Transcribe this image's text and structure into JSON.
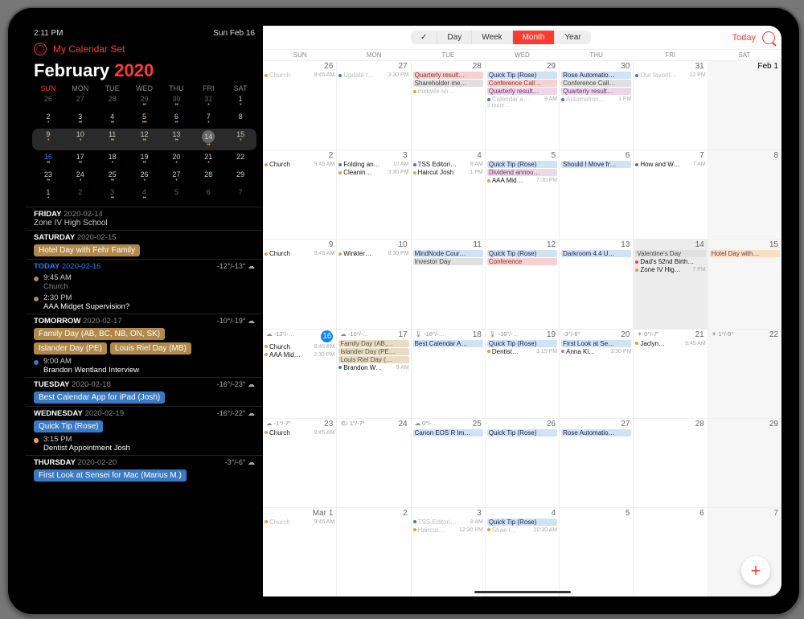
{
  "status": {
    "time": "2:11 PM",
    "date": "Sun Feb 16"
  },
  "side": {
    "calendarSet": "My Calendar Set",
    "month": "February",
    "year": "2020",
    "mini": {
      "dow": [
        "SUN",
        "MON",
        "TUE",
        "WED",
        "THU",
        "FRI",
        "SAT"
      ],
      "weeks": [
        {
          "d": [
            "26",
            "27",
            "28",
            "29",
            "30",
            "31",
            "1"
          ],
          "dim": [
            0,
            1,
            2,
            3,
            4,
            5
          ],
          "dots": [
            "",
            "",
            "",
            "••",
            "••",
            "•",
            "•"
          ]
        },
        {
          "d": [
            "2",
            "3",
            "4",
            "5",
            "6",
            "7",
            "8"
          ],
          "dots": [
            "•",
            "••",
            "••",
            "•••",
            "••",
            "•",
            ""
          ]
        },
        {
          "sel": true,
          "d": [
            "9",
            "10",
            "11",
            "12",
            "13",
            "14",
            "15"
          ],
          "dots": [
            "•",
            "•",
            "••",
            "••",
            "••",
            "••",
            "•"
          ],
          "big": 5
        },
        {
          "today": 0,
          "d": [
            "16",
            "17",
            "18",
            "19",
            "20",
            "21",
            "22"
          ],
          "dots": [
            "••",
            "••",
            "•",
            "••",
            "•",
            "•",
            ""
          ]
        },
        {
          "d": [
            "23",
            "24",
            "25",
            "26",
            "27",
            "28",
            "29"
          ],
          "dots": [
            "••",
            "•",
            "••",
            "•",
            "•",
            "",
            ""
          ]
        },
        {
          "d": [
            "1",
            "2",
            "3",
            "4",
            "5",
            "6",
            "7"
          ],
          "dim": [
            1,
            2,
            3,
            4,
            5,
            6
          ],
          "dots": [
            "•",
            "",
            "••",
            "••",
            "",
            "",
            ""
          ]
        }
      ]
    },
    "agenda": [
      {
        "hd": {
          "day": "FRIDAY",
          "date": "2020-02-14"
        },
        "items": [
          {
            "kind": "txt",
            "title": "Zone IV High School"
          }
        ]
      },
      {
        "hd": {
          "day": "SATURDAY",
          "date": "2020-02-15"
        },
        "items": [
          {
            "kind": "pill",
            "cls": "",
            "label": "Hotel Day with Fehr Family"
          }
        ]
      },
      {
        "hd": {
          "day": "TODAY",
          "date": "2020-02-16",
          "today": true,
          "temp": "-12°/-13°"
        },
        "items": [
          {
            "kind": "ev",
            "dot": "#b1894a",
            "time": "9:45 AM",
            "title": "Church",
            "dim": true
          },
          {
            "kind": "ev",
            "dot": "#b1894a",
            "time": "2:30 PM",
            "title": "AAA Midget Supervision?"
          }
        ]
      },
      {
        "hd": {
          "day": "TOMORROW",
          "date": "2020-02-17",
          "temp": "-10°/-19°"
        },
        "items": [
          {
            "kind": "pill",
            "cls": "",
            "label": "Family Day (AB, BC, NB, ON, SK)"
          },
          {
            "kind": "pillrow",
            "pills": [
              {
                "label": "Islander Day (PE)"
              },
              {
                "label": "Louis Riel Day (MB)"
              }
            ]
          },
          {
            "kind": "ev",
            "dot": "#3a7ac4",
            "time": "9:00 AM",
            "title": "Brandon Wentland Interview"
          }
        ]
      },
      {
        "hd": {
          "day": "TUESDAY",
          "date": "2020-02-18",
          "temp": "-16°/-23°"
        },
        "items": [
          {
            "kind": "pill",
            "cls": "blue",
            "label": "Best Calendar App for iPad (Josh)"
          }
        ]
      },
      {
        "hd": {
          "day": "WEDNESDAY",
          "date": "2020-02-19",
          "temp": "-16°/-22°"
        },
        "items": [
          {
            "kind": "pill",
            "cls": "blue",
            "label": "Quick Tip (Rose)"
          },
          {
            "kind": "ev",
            "dot": "#f0a35a",
            "time": "3:15 PM",
            "title": "Dentist Appointment Josh"
          }
        ]
      },
      {
        "hd": {
          "day": "THURSDAY",
          "date": "2020-02-20",
          "temp": "-3°/-6°"
        },
        "items": [
          {
            "kind": "pill",
            "cls": "blue",
            "label": "First Look at Sensei for Mac (Marius M.)"
          }
        ]
      }
    ]
  },
  "main": {
    "today": "Today",
    "seg": [
      {
        "l": "",
        "chk": true
      },
      {
        "l": "Day"
      },
      {
        "l": "Week"
      },
      {
        "l": "Month",
        "on": true
      },
      {
        "l": "Year"
      }
    ],
    "dow": [
      "SUN",
      "MON",
      "TUE",
      "WED",
      "THU",
      "FRI",
      "SAT"
    ],
    "rows": [
      [
        {
          "n": "26",
          "g": 1,
          "ev": [
            {
              "d": "#e0a040",
              "t": "Church",
              "tm": "9:45 AM"
            }
          ]
        },
        {
          "n": "27",
          "g": 1,
          "ev": [
            {
              "d": "#3a7ac4",
              "t": "Update t…",
              "tm": "3:30 PM"
            }
          ]
        },
        {
          "n": "28",
          "g": 1,
          "bars": [
            {
              "c": "rd",
              "t": "Quarterly result…"
            },
            {
              "c": "gy",
              "t": "Shareholder me…"
            }
          ],
          "ev": [
            {
              "d": "#e0a040",
              "t": "midwife sh…"
            }
          ]
        },
        {
          "n": "29",
          "g": 1,
          "bars": [
            {
              "c": "bl",
              "t": "Quick Tip (Rose)"
            },
            {
              "c": "rd",
              "t": "Conference Call…"
            },
            {
              "c": "pk",
              "t": "Quarterly result…"
            }
          ],
          "ev": [
            {
              "d": "#3a7ac4",
              "t": "Calendar a…",
              "tm": "9 AM"
            }
          ],
          "more": "3 more…"
        },
        {
          "n": "30",
          "g": 1,
          "bars": [
            {
              "c": "bl",
              "t": "Rose Automatio…"
            },
            {
              "c": "gy",
              "t": "Conference Call…"
            },
            {
              "c": "pk",
              "t": "Quarterly result…"
            }
          ],
          "ev": [
            {
              "d": "#3a7ac4",
              "t": "Automation…",
              "tm": "1 PM"
            }
          ]
        },
        {
          "n": "31",
          "g": 1,
          "ev": [
            {
              "d": "#3a7ac4",
              "t": "Our favorit…",
              "tm": "12 PM"
            }
          ]
        },
        {
          "n": "Feb 1",
          "bold": 1
        }
      ],
      [
        {
          "n": "2",
          "ev": [
            {
              "d": "#e0a040",
              "t": "Church",
              "tm": "9:45 AM"
            }
          ]
        },
        {
          "n": "3",
          "ev": [
            {
              "d": "#3a7ac4",
              "t": "Folding an…",
              "tm": "10 AM"
            },
            {
              "d": "#e0a040",
              "t": "Cleanin…",
              "tm": "3:30 PM"
            }
          ]
        },
        {
          "n": "4",
          "ev": [
            {
              "d": "#3a7ac4",
              "t": "TSS Editori…",
              "tm": "8 AM"
            },
            {
              "d": "#e0a040",
              "t": "Haircut Josh",
              "tm": "1 PM"
            }
          ]
        },
        {
          "n": "5",
          "bars": [
            {
              "c": "bl",
              "t": "Quick Tip (Rose)"
            },
            {
              "c": "pk",
              "t": "Dividend annou…"
            }
          ],
          "ev": [
            {
              "d": "#e0a040",
              "t": "AAA Mid…",
              "tm": "7:30 PM"
            }
          ]
        },
        {
          "n": "6",
          "bars": [
            {
              "c": "bl",
              "t": "Should I Move fr…"
            }
          ]
        },
        {
          "n": "7",
          "ev": [
            {
              "d": "#3a7ac4",
              "t": "How and W…",
              "tm": "7 AM"
            }
          ]
        },
        {
          "n": "8"
        }
      ],
      [
        {
          "n": "9",
          "ev": [
            {
              "d": "#e0a040",
              "t": "Church",
              "tm": "9:45 AM"
            }
          ]
        },
        {
          "n": "10",
          "ev": [
            {
              "d": "#e0a040",
              "t": "Winkler…",
              "tm": "8:30 PM"
            }
          ]
        },
        {
          "n": "11",
          "bars": [
            {
              "c": "bl",
              "t": "MindNode Cour…"
            },
            {
              "c": "gy",
              "t": "Investor Day"
            }
          ]
        },
        {
          "n": "12",
          "bars": [
            {
              "c": "bl",
              "t": "Quick Tip (Rose)"
            },
            {
              "c": "rd",
              "t": "Conference"
            }
          ]
        },
        {
          "n": "13",
          "bars": [
            {
              "c": "bl",
              "t": "Darkroom 4.4 U…"
            }
          ]
        },
        {
          "n": "14",
          "sel": 1,
          "bars": [
            {
              "c": "gy",
              "t": "Valentine's Day"
            }
          ],
          "ev": [
            {
              "d": "#ff3b30",
              "t": "Dad's 52nd Birth…"
            },
            {
              "d": "#e0a040",
              "t": "Zone IV Hig…",
              "tm": "7 PM"
            }
          ]
        },
        {
          "n": "15",
          "bars": [
            {
              "c": "or",
              "t": "Hotel Day with…"
            }
          ]
        }
      ],
      [
        {
          "n": "16",
          "today": 1,
          "wx": "☁ -12°/-…",
          "ev": [
            {
              "d": "#e0a040",
              "t": "Church",
              "tm": "9:45 AM"
            },
            {
              "d": "#e0a040",
              "t": "AAA Mid…",
              "tm": "2:30 PM"
            }
          ]
        },
        {
          "n": "17",
          "wx": "☁ -10°/-…",
          "bars": [
            {
              "c": "tan",
              "t": "Family Day (AB,…"
            },
            {
              "c": "tan",
              "t": "Islander Day (PE…"
            },
            {
              "c": "tan",
              "t": "Louis Riel Day (…"
            }
          ],
          "ev": [
            {
              "d": "#3a7ac4",
              "t": "Brandon W…",
              "tm": "9 AM"
            }
          ]
        },
        {
          "n": "18",
          "wx": "🌡 -16°/-…",
          "bars": [
            {
              "c": "bl",
              "t": "Best Calendar A…"
            }
          ]
        },
        {
          "n": "19",
          "wx": "🌡 -16°/-…",
          "bars": [
            {
              "c": "bl",
              "t": "Quick Tip (Rose)"
            }
          ],
          "ev": [
            {
              "d": "#e0a040",
              "t": "Dentist…",
              "tm": "3:15 PM"
            }
          ]
        },
        {
          "n": "20",
          "wx": "-3°/-6°",
          "bars": [
            {
              "c": "bl",
              "t": "First Look at Se…"
            }
          ],
          "ev": [
            {
              "d": "#cc66cc",
              "t": "Anna Ki…",
              "tm": "3:30 PM"
            }
          ]
        },
        {
          "n": "21",
          "wx": "☀ 0°/-7°",
          "ev": [
            {
              "d": "#e0a040",
              "t": "Jaclyn…",
              "tm": "9:45 AM"
            }
          ]
        },
        {
          "n": "22",
          "wx": "☀ 1°/-9°"
        }
      ],
      [
        {
          "n": "23",
          "wx": "☁ -1°/-7°",
          "ev": [
            {
              "d": "#e0a040",
              "t": "Church",
              "tm": "9:45 AM"
            }
          ]
        },
        {
          "n": "24",
          "wx": "🌤 1°/-7°"
        },
        {
          "n": "25",
          "wx": "☁ 0°/-…",
          "bars": [
            {
              "c": "bl",
              "t": "Canon EOS R Im…"
            }
          ]
        },
        {
          "n": "26",
          "bars": [
            {
              "c": "bl",
              "t": "Quick Tip (Rose)"
            }
          ]
        },
        {
          "n": "27",
          "bars": [
            {
              "c": "bl",
              "t": "Rose Automatio…"
            }
          ]
        },
        {
          "n": "28"
        },
        {
          "n": "29"
        }
      ],
      [
        {
          "n": "Mar 1",
          "g": 1,
          "ev": [
            {
              "d": "#e0a040",
              "t": "Church",
              "tm": "9:45 AM"
            }
          ]
        },
        {
          "n": "2",
          "g": 1
        },
        {
          "n": "3",
          "g": 1,
          "ev": [
            {
              "d": "#3a7ac4",
              "t": "TSS Editori…",
              "tm": "8 AM"
            },
            {
              "d": "#e0a040",
              "t": "Haircut…",
              "tm": "12:30 PM"
            }
          ]
        },
        {
          "n": "4",
          "g": 1,
          "bars": [
            {
              "c": "bl",
              "t": "Quick Tip (Rose)"
            }
          ],
          "ev": [
            {
              "d": "#e0a040",
              "t": "Shae i…",
              "tm": "10:30 AM"
            }
          ]
        },
        {
          "n": "5",
          "g": 1
        },
        {
          "n": "6",
          "g": 1
        },
        {
          "n": "7",
          "g": 1
        }
      ]
    ]
  }
}
